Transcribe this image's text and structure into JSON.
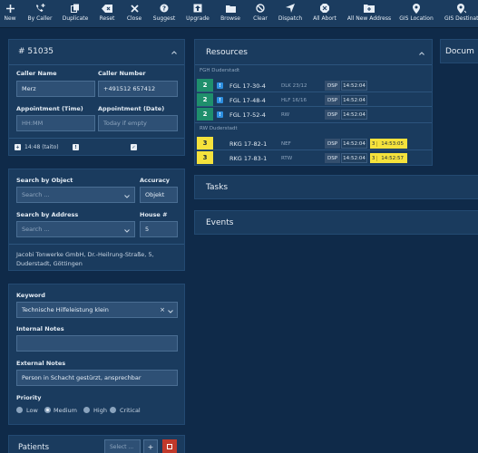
{
  "toolbar": [
    {
      "id": "new",
      "label": "New",
      "icon": "plus-icon"
    },
    {
      "id": "by-caller",
      "label": "By Caller",
      "icon": "phone-plus-icon"
    },
    {
      "id": "duplicate",
      "label": "Duplicate",
      "icon": "duplicate-icon"
    },
    {
      "id": "reset",
      "label": "Reset",
      "icon": "reset-icon"
    },
    {
      "id": "close",
      "label": "Close",
      "icon": "close-icon"
    },
    {
      "id": "suggest",
      "label": "Suggest",
      "icon": "question-icon"
    },
    {
      "id": "upgrade",
      "label": "Upgrade",
      "icon": "upgrade-icon"
    },
    {
      "id": "browse",
      "label": "Browse",
      "icon": "browse-icon"
    },
    {
      "id": "clear",
      "label": "Clear",
      "icon": "clear-icon"
    },
    {
      "id": "dispatch",
      "label": "Dispatch",
      "icon": "dispatch-icon"
    },
    {
      "id": "all-abort",
      "label": "All Abort",
      "icon": "abort-icon"
    },
    {
      "id": "all-new-address",
      "label": "All New Address",
      "icon": "new-address-icon"
    },
    {
      "id": "gis-location",
      "label": "GIS Location",
      "icon": "location-pin-icon"
    },
    {
      "id": "gis-destination",
      "label": "GIS Destinati",
      "icon": "destination-pin-icon"
    }
  ],
  "incident": {
    "number": "# 51035",
    "caller_name_label": "Caller Name",
    "caller_name": "Merz",
    "caller_number_label": "Caller Number",
    "caller_number": "+491512 657412",
    "appt_time_label": "Appointment (Time)",
    "appt_time_placeholder": "HH:MM",
    "appt_date_label": "Appointment (Date)",
    "appt_date_placeholder": "Today if empty",
    "status_time": "14:48 (taito)"
  },
  "location": {
    "search_object_label": "Search by Object",
    "search_object_placeholder": "Search ...",
    "accuracy_label": "Accuracy",
    "accuracy_value": "Objekt",
    "search_address_label": "Search by Address",
    "search_address_placeholder": "Search ...",
    "house_label": "House #",
    "house_value": "5",
    "address_line1": "Jacobi Tonwerke GmbH, Dr.-Heilrung-Straße, 5,",
    "address_line2": "Duderstadt, Göttingen"
  },
  "details": {
    "keyword_label": "Keyword",
    "keyword_value": "Technische Hilfeleistung klein",
    "internal_notes_label": "Internal Notes",
    "external_notes_label": "External Notes",
    "external_notes_value": "Person in Schacht gestürzt, ansprechbar",
    "priority_label": "Priority",
    "priorities": [
      "Low",
      "Medium",
      "High",
      "Critical"
    ],
    "selected_priority": "Medium"
  },
  "patients": {
    "title": "Patients",
    "select_placeholder": "Select ..."
  },
  "resources": {
    "title": "Resources",
    "group1": "FGH Duderstadt",
    "group2": "RW Duderstadt",
    "rows": [
      {
        "status": "2",
        "name": "FGL 17-30-4",
        "type": "DLK 23/12",
        "dsp": "DSP",
        "time": "14:52:04"
      },
      {
        "status": "2",
        "name": "FGL 17-48-4",
        "type": "HLF 16/16",
        "dsp": "DSP",
        "time": "14:52:04"
      },
      {
        "status": "2",
        "name": "FGL 17-52-4",
        "type": "RW",
        "dsp": "DSP",
        "time": "14:52:04"
      },
      {
        "status": "3",
        "name": "RKG 17-82-1",
        "type": "NEF",
        "dsp": "DSP",
        "time": "14:52:04",
        "s3": "3",
        "s3time": "14:53:05"
      },
      {
        "status": "3",
        "name": "RKG 17-83-1",
        "type": "RTW",
        "dsp": "DSP",
        "time": "14:52:04",
        "s3": "3",
        "s3time": "14:52:57"
      }
    ]
  },
  "tasks": {
    "title": "Tasks"
  },
  "events": {
    "title": "Events"
  },
  "documents": {
    "title": "Docum"
  },
  "colors": {
    "background": "#0f2a49",
    "panel": "#1a3b5e",
    "status2": "#1f8f6c",
    "status3": "#f5e23c"
  }
}
